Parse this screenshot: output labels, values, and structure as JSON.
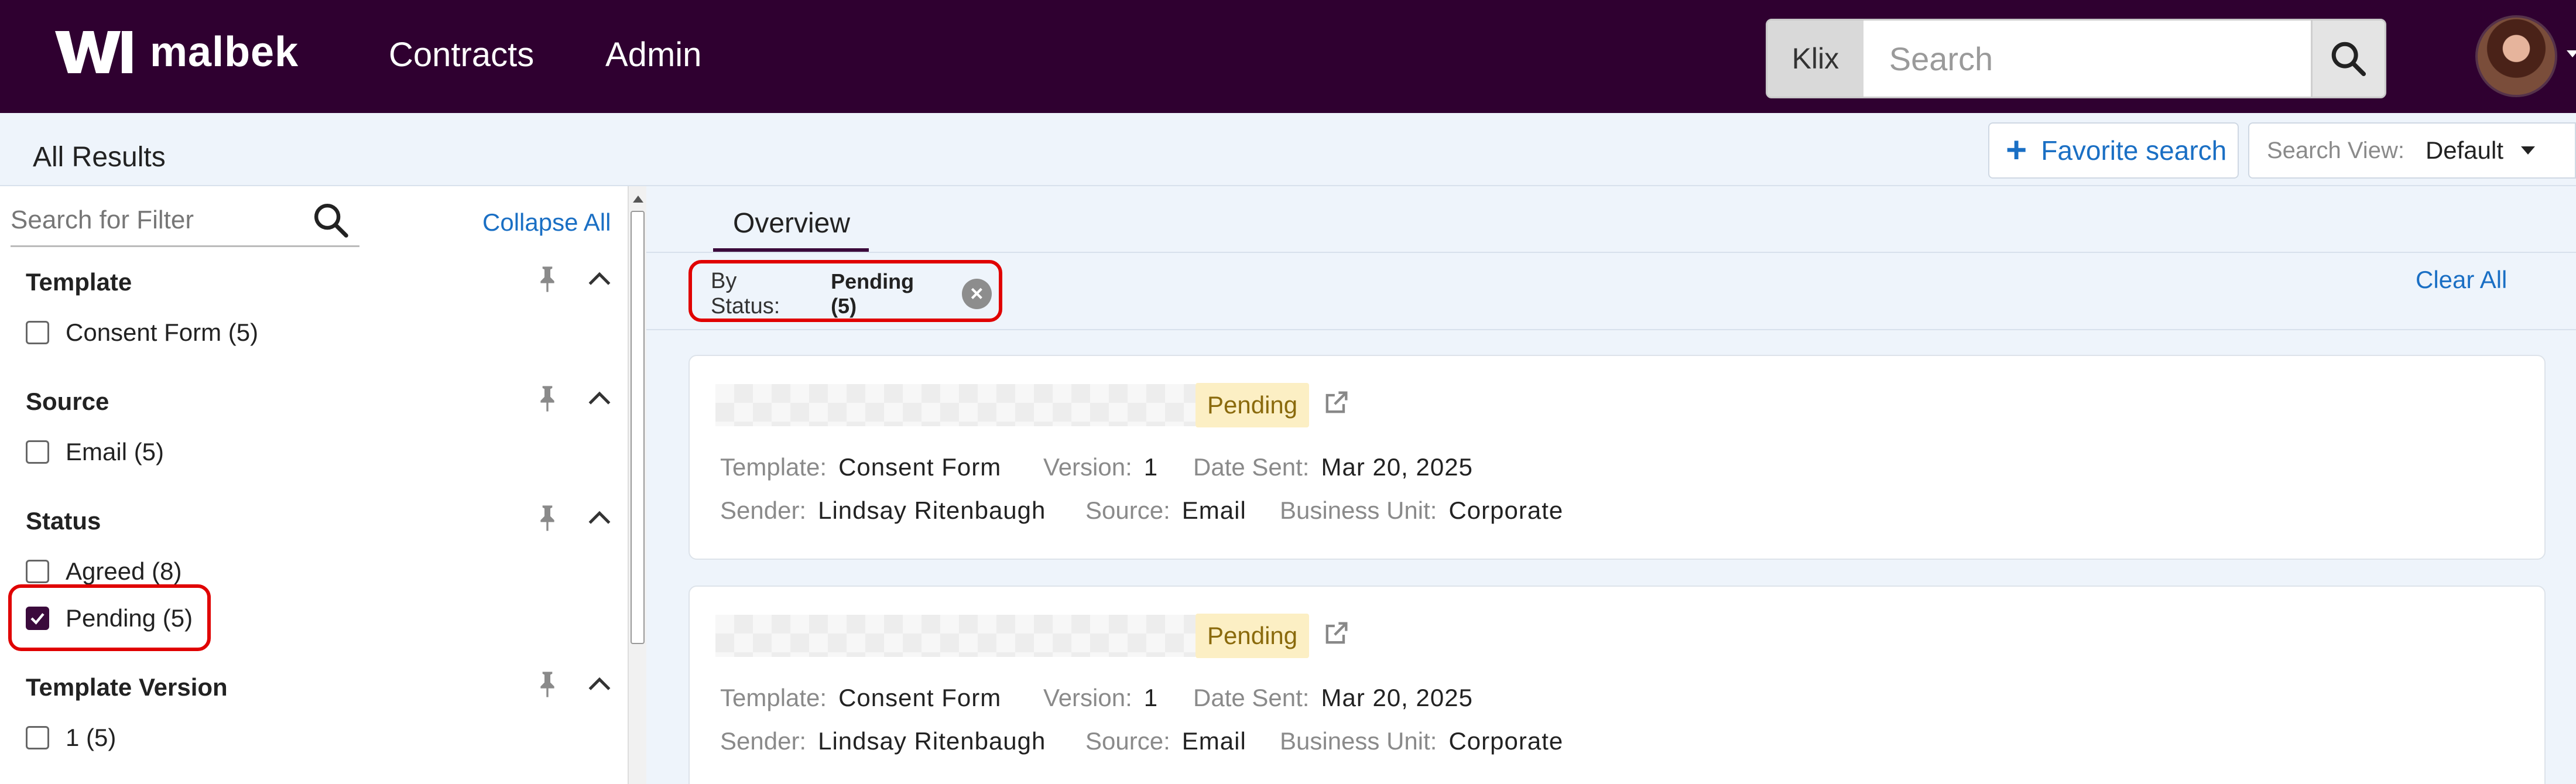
{
  "brand": {
    "name": "malbek"
  },
  "nav": {
    "items": [
      "Contracts",
      "Admin"
    ]
  },
  "search": {
    "scope": "Klix",
    "placeholder": "Search"
  },
  "subheader": {
    "title": "All Results",
    "favorite_label": "Favorite search",
    "view_label": "Search View:",
    "view_value": "Default"
  },
  "sidebar": {
    "filter_placeholder": "Search for Filter",
    "collapse_all": "Collapse All",
    "facets": [
      {
        "title": "Template",
        "options": [
          {
            "label": "Consent Form (5)",
            "checked": false
          }
        ]
      },
      {
        "title": "Source",
        "options": [
          {
            "label": "Email (5)",
            "checked": false
          }
        ]
      },
      {
        "title": "Status",
        "options": [
          {
            "label": "Agreed (8)",
            "checked": false
          },
          {
            "label": "Pending (5)",
            "checked": true
          }
        ]
      },
      {
        "title": "Template Version",
        "options": [
          {
            "label": "1 (5)",
            "checked": false
          }
        ]
      }
    ]
  },
  "main": {
    "tab": "Overview",
    "chip": {
      "label": "By Status:",
      "value": "Pending (5)"
    },
    "clear_all": "Clear All",
    "results": [
      {
        "status": "Pending",
        "template_key": "Template:",
        "template": "Consent Form",
        "version_key": "Version:",
        "version": "1",
        "date_key": "Date Sent:",
        "date": "Mar 20, 2025",
        "sender_key": "Sender:",
        "sender": "Lindsay Ritenbaugh",
        "source_key": "Source:",
        "source": "Email",
        "bu_key": "Business Unit:",
        "bu": "Corporate"
      },
      {
        "status": "Pending",
        "template_key": "Template:",
        "template": "Consent Form",
        "version_key": "Version:",
        "version": "1",
        "date_key": "Date Sent:",
        "date": "Mar 20, 2025",
        "sender_key": "Sender:",
        "sender": "Lindsay Ritenbaugh",
        "source_key": "Source:",
        "source": "Email",
        "bu_key": "Business Unit:",
        "bu": "Corporate"
      }
    ]
  },
  "colors": {
    "topbar": "#2f0030",
    "accent": "#1a6fc4",
    "highlight": "#e00000",
    "badge_bg": "#fcefc4"
  }
}
